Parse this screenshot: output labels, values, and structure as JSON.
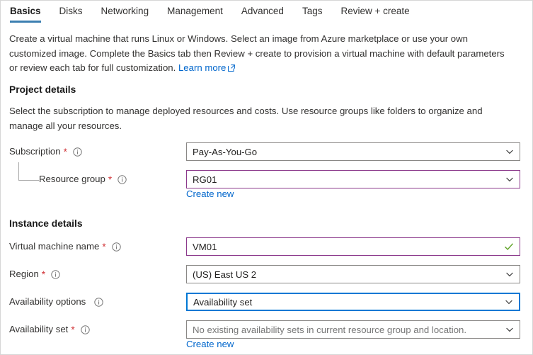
{
  "tabs": [
    {
      "label": "Basics",
      "active": true
    },
    {
      "label": "Disks",
      "active": false
    },
    {
      "label": "Networking",
      "active": false
    },
    {
      "label": "Management",
      "active": false
    },
    {
      "label": "Advanced",
      "active": false
    },
    {
      "label": "Tags",
      "active": false
    },
    {
      "label": "Review + create",
      "active": false
    }
  ],
  "intro": {
    "text": "Create a virtual machine that runs Linux or Windows. Select an image from Azure marketplace or use your own customized image. Complete the Basics tab then Review + create to provision a virtual machine with default parameters or review each tab for full customization. ",
    "link_label": "Learn more",
    "link_icon": "external-link-icon"
  },
  "project_details": {
    "title": "Project details",
    "description": "Select the subscription to manage deployed resources and costs. Use resource groups like folders to organize and manage all your resources.",
    "subscription": {
      "label": "Subscription",
      "required": "*",
      "info_icon": "info-icon",
      "value": "Pay-As-You-Go",
      "chevron_icon": "chevron-down-icon"
    },
    "resource_group": {
      "label": "Resource group",
      "required": "*",
      "info_icon": "info-icon",
      "value": "RG01",
      "chevron_icon": "chevron-down-icon",
      "create_new_label": "Create new",
      "border_color": "#8c3a8c"
    }
  },
  "instance_details": {
    "title": "Instance details",
    "vm_name": {
      "label": "Virtual machine name",
      "required": "*",
      "info_icon": "info-icon",
      "value": "VM01",
      "valid_icon": "checkmark-icon",
      "valid_color": "#5ea226",
      "border_color": "#8c3a8c"
    },
    "region": {
      "label": "Region",
      "required": "*",
      "info_icon": "info-icon",
      "value": "(US) East US 2",
      "chevron_icon": "chevron-down-icon"
    },
    "availability_options": {
      "label": "Availability options",
      "required": "",
      "info_icon": "info-icon",
      "value": "Availability set",
      "chevron_icon": "chevron-down-icon",
      "border_color": "#0078d4"
    },
    "availability_set": {
      "label": "Availability set",
      "required": "*",
      "info_icon": "info-icon",
      "placeholder_value": "No existing availability sets in current resource group and location.",
      "chevron_icon": "chevron-down-icon",
      "create_new_label": "Create new"
    }
  }
}
